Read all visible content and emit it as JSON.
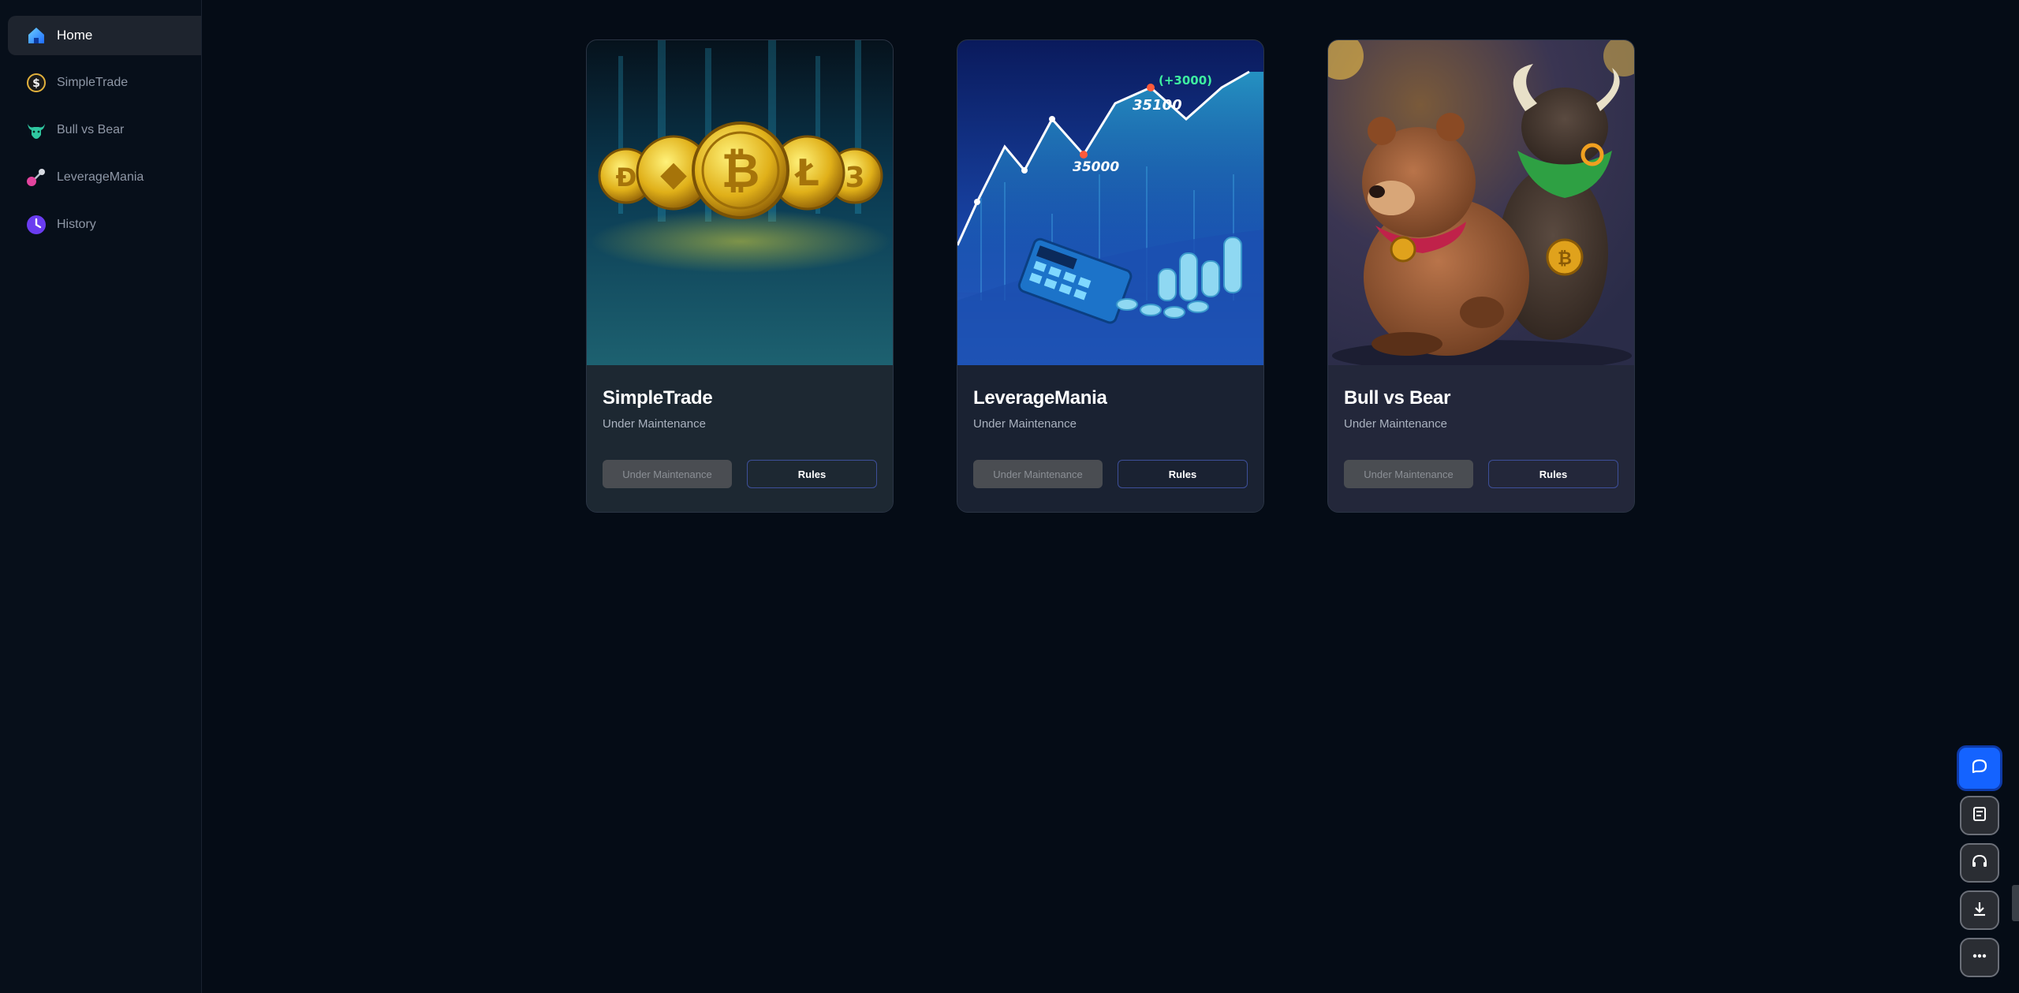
{
  "sidebar": {
    "items": [
      {
        "label": "Home",
        "icon": "home-icon",
        "active": true
      },
      {
        "label": "SimpleTrade",
        "icon": "dollar-coin-icon",
        "active": false
      },
      {
        "label": "Bull vs Bear",
        "icon": "bull-icon",
        "active": false
      },
      {
        "label": "LeverageMania",
        "icon": "joystick-icon",
        "active": false
      },
      {
        "label": "History",
        "icon": "clock-icon",
        "active": false
      }
    ]
  },
  "games": [
    {
      "title": "SimpleTrade",
      "status": "Under Maintenance",
      "primary_button": "Under Maintenance",
      "rules_button": "Rules",
      "image": "crypto-coins-image"
    },
    {
      "title": "LeverageMania",
      "status": "Under Maintenance",
      "primary_button": "Under Maintenance",
      "rules_button": "Rules",
      "image": "price-chart-calculator-image",
      "image_text": {
        "peak_gain": "(+3000)",
        "peak_price": "35100",
        "low_price": "35000"
      }
    },
    {
      "title": "Bull vs Bear",
      "status": "Under Maintenance",
      "primary_button": "Under Maintenance",
      "rules_button": "Rules",
      "image": "bull-and-bear-image"
    }
  ],
  "floating_actions": [
    {
      "icon": "chat-bubble-icon",
      "primary": true
    },
    {
      "icon": "receipt-icon",
      "primary": false
    },
    {
      "icon": "headset-icon",
      "primary": false
    },
    {
      "icon": "download-icon",
      "primary": false
    },
    {
      "icon": "more-dots-icon",
      "primary": false
    }
  ],
  "colors": {
    "background": "#050c16",
    "accent_blue": "#1463ff",
    "rules_border": "#3d4f99",
    "maintenance_button": "#4a4d52"
  }
}
